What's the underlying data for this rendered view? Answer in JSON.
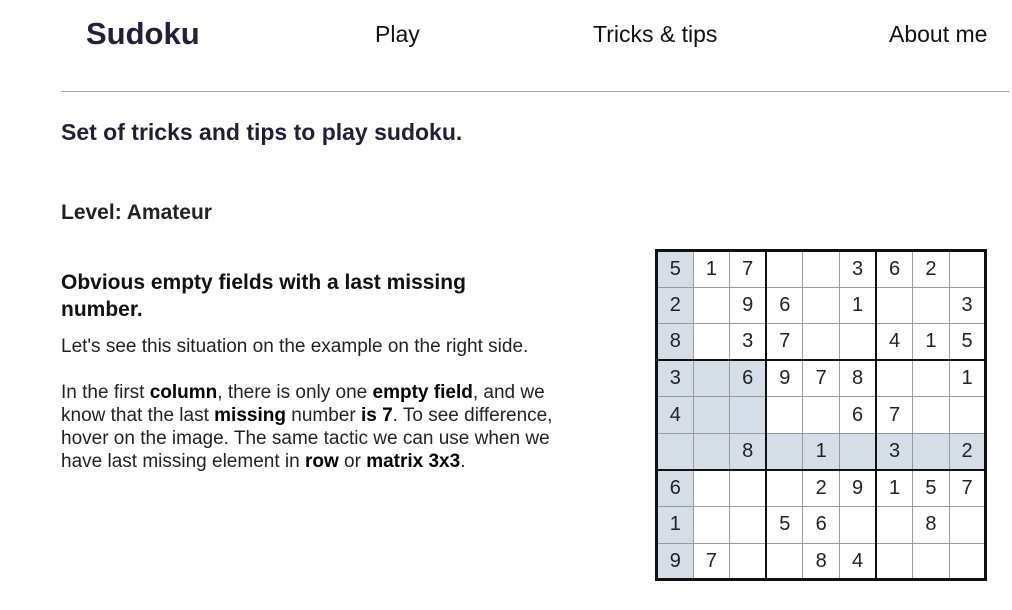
{
  "nav": {
    "brand": "Sudoku",
    "links": [
      "Play",
      "Tricks & tips",
      "About me"
    ]
  },
  "page": {
    "title": "Set of tricks and tips to play sudoku.",
    "level": "Level: Amateur"
  },
  "tip": {
    "title": "Obvious empty fields with a last missing number.",
    "intro": "Let's see this situation on the example on the right side.",
    "body": [
      {
        "t": "In the first ",
        "b": false
      },
      {
        "t": "column",
        "b": true
      },
      {
        "t": ", there is only one ",
        "b": false
      },
      {
        "t": "empty field",
        "b": true
      },
      {
        "t": ", and we know that the last ",
        "b": false
      },
      {
        "t": "missing",
        "b": true
      },
      {
        "t": " number ",
        "b": false
      },
      {
        "t": "is 7",
        "b": true
      },
      {
        "t": ". To see difference, hover on the image. The same tactic we can use when we have last missing element in ",
        "b": false
      },
      {
        "t": "row",
        "b": true
      },
      {
        "t": " or ",
        "b": false
      },
      {
        "t": "matrix 3x3",
        "b": true
      },
      {
        "t": ".",
        "b": false
      }
    ]
  },
  "sudoku": {
    "grid": [
      [
        "5",
        "1",
        "7",
        "",
        "",
        "3",
        "6",
        "2",
        ""
      ],
      [
        "2",
        "",
        "9",
        "6",
        "",
        "1",
        "",
        "",
        "3"
      ],
      [
        "8",
        "",
        "3",
        "7",
        "",
        "",
        "4",
        "1",
        "5"
      ],
      [
        "3",
        "",
        "6",
        "9",
        "7",
        "8",
        "",
        "",
        "1"
      ],
      [
        "4",
        "",
        "",
        "",
        "",
        "6",
        "7",
        "",
        ""
      ],
      [
        "",
        "",
        "8",
        "",
        "1",
        "",
        "3",
        "",
        "2"
      ],
      [
        "6",
        "",
        "",
        "",
        "2",
        "9",
        "1",
        "5",
        "7"
      ],
      [
        "1",
        "",
        "",
        "5",
        "6",
        "",
        "",
        "8",
        ""
      ],
      [
        "9",
        "7",
        "",
        "",
        "8",
        "4",
        "",
        "",
        ""
      ]
    ],
    "highlighted": [
      [
        0,
        0
      ],
      [
        1,
        0
      ],
      [
        2,
        0
      ],
      [
        3,
        0
      ],
      [
        4,
        0
      ],
      [
        5,
        0
      ],
      [
        6,
        0
      ],
      [
        7,
        0
      ],
      [
        8,
        0
      ],
      [
        3,
        1
      ],
      [
        3,
        2
      ],
      [
        4,
        1
      ],
      [
        4,
        2
      ],
      [
        5,
        1
      ],
      [
        5,
        2
      ],
      [
        5,
        3
      ],
      [
        5,
        4
      ],
      [
        5,
        5
      ],
      [
        5,
        6
      ],
      [
        5,
        7
      ],
      [
        5,
        8
      ]
    ],
    "highlight_color": "#d5dee6"
  }
}
